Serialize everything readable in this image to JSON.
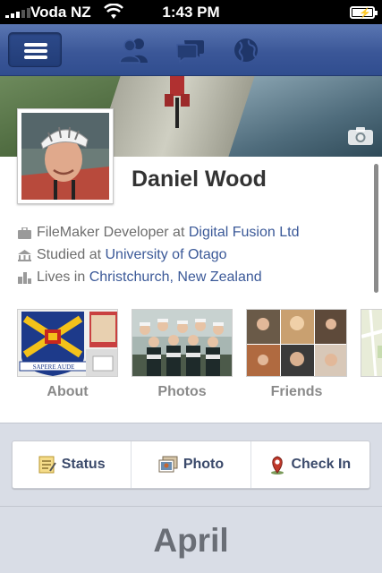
{
  "status_bar": {
    "carrier": "Voda NZ",
    "time": "1:43 PM"
  },
  "nav": {
    "icons": [
      "menu-icon",
      "friends-icon",
      "messages-icon",
      "notifications-globe-icon"
    ]
  },
  "profile": {
    "name": "Daniel Wood",
    "work": {
      "prefix": "FileMaker Developer at ",
      "link": "Digital Fusion Ltd"
    },
    "education": {
      "prefix": "Studied at ",
      "link": "University of Otago"
    },
    "location": {
      "prefix": "Lives in ",
      "link": "Christchurch, New Zealand"
    }
  },
  "tiles": [
    {
      "label": "About"
    },
    {
      "label": "Photos"
    },
    {
      "label": "Friends"
    }
  ],
  "crest_motto": "SAPERE AUDE",
  "actions": [
    {
      "label": "Status",
      "icon": "status-note-icon"
    },
    {
      "label": "Photo",
      "icon": "photo-icon"
    },
    {
      "label": "Check In",
      "icon": "check-in-pin-icon"
    }
  ],
  "timeline": {
    "month": "April"
  },
  "colors": {
    "brand": "#3b5998",
    "nav_bg": "#3b5798",
    "link": "#3b5998"
  }
}
